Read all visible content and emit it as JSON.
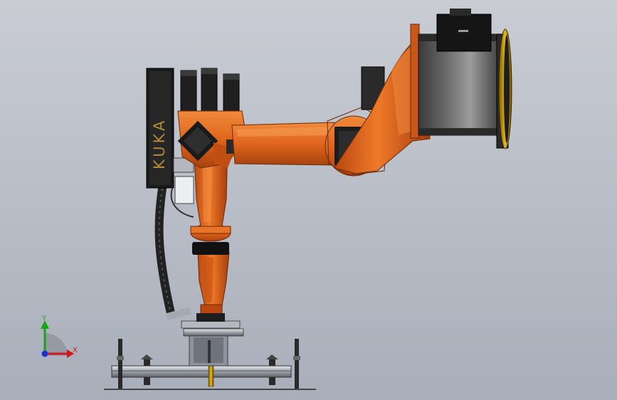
{
  "viewport": {
    "background_top": "#c9ccd3",
    "background_bottom": "#a9afba"
  },
  "model": {
    "brand_text": "KUKA",
    "robot_color": "#e0651d",
    "dark_color": "#1c1c1c"
  },
  "triad": {
    "x_label": "X",
    "y_label": "Y",
    "x_color": "#d01818",
    "y_color": "#18a318",
    "z_color": "#2030d0"
  }
}
